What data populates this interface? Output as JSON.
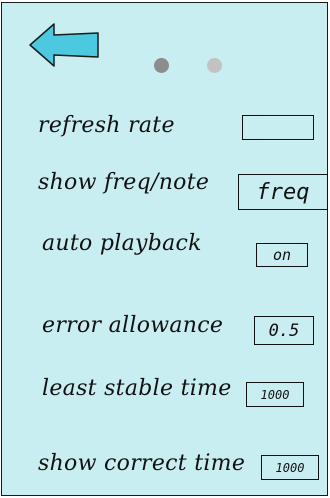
{
  "screen": {
    "background_color": "#c9eef1",
    "accent_arrow_color": "#4cc8e0",
    "pager": {
      "dots": 2,
      "active_index": 0
    }
  },
  "back_button": {
    "icon": "back-arrow-icon"
  },
  "settings": [
    {
      "label": "refresh rate",
      "value": ""
    },
    {
      "label": "show freq/note",
      "value": "freq"
    },
    {
      "label": "auto playback",
      "value": "on"
    },
    {
      "label": "error allowance",
      "value": "0.5"
    },
    {
      "label": "least stable time",
      "value": "1000"
    },
    {
      "label": "show correct time",
      "value": "1000"
    }
  ]
}
